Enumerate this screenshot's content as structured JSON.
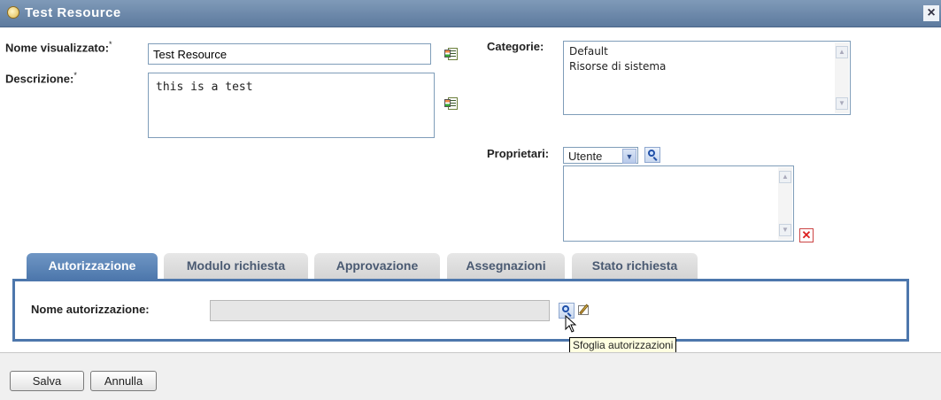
{
  "window": {
    "title": "Test Resource",
    "close": "×"
  },
  "form": {
    "display_name_label": "Nome visualizzato:",
    "display_name_value": "Test Resource",
    "description_label": "Descrizione:",
    "description_value": "this is a test",
    "required_mark": "*",
    "categories_label": "Categorie:",
    "categories": [
      "Default",
      "Risorse di sistema"
    ],
    "owners_label": "Proprietari:",
    "owner_type": "Utente"
  },
  "tabs": [
    {
      "label": "Autorizzazione",
      "active": true
    },
    {
      "label": "Modulo richiesta",
      "active": false
    },
    {
      "label": "Approvazione",
      "active": false
    },
    {
      "label": "Assegnazioni",
      "active": false
    },
    {
      "label": "Stato richiesta",
      "active": false
    }
  ],
  "panel": {
    "entitlement_label": "Nome autorizzazione:",
    "entitlement_value": "",
    "tooltip": "Sfoglia autorizzazioni"
  },
  "footer": {
    "save": "Salva",
    "cancel": "Annulla"
  },
  "colors": {
    "title_bar": "#5d7a9e",
    "active_tab": "#4d77ac",
    "tab_text": "#4a5a72",
    "delete_red": "#d22222"
  }
}
